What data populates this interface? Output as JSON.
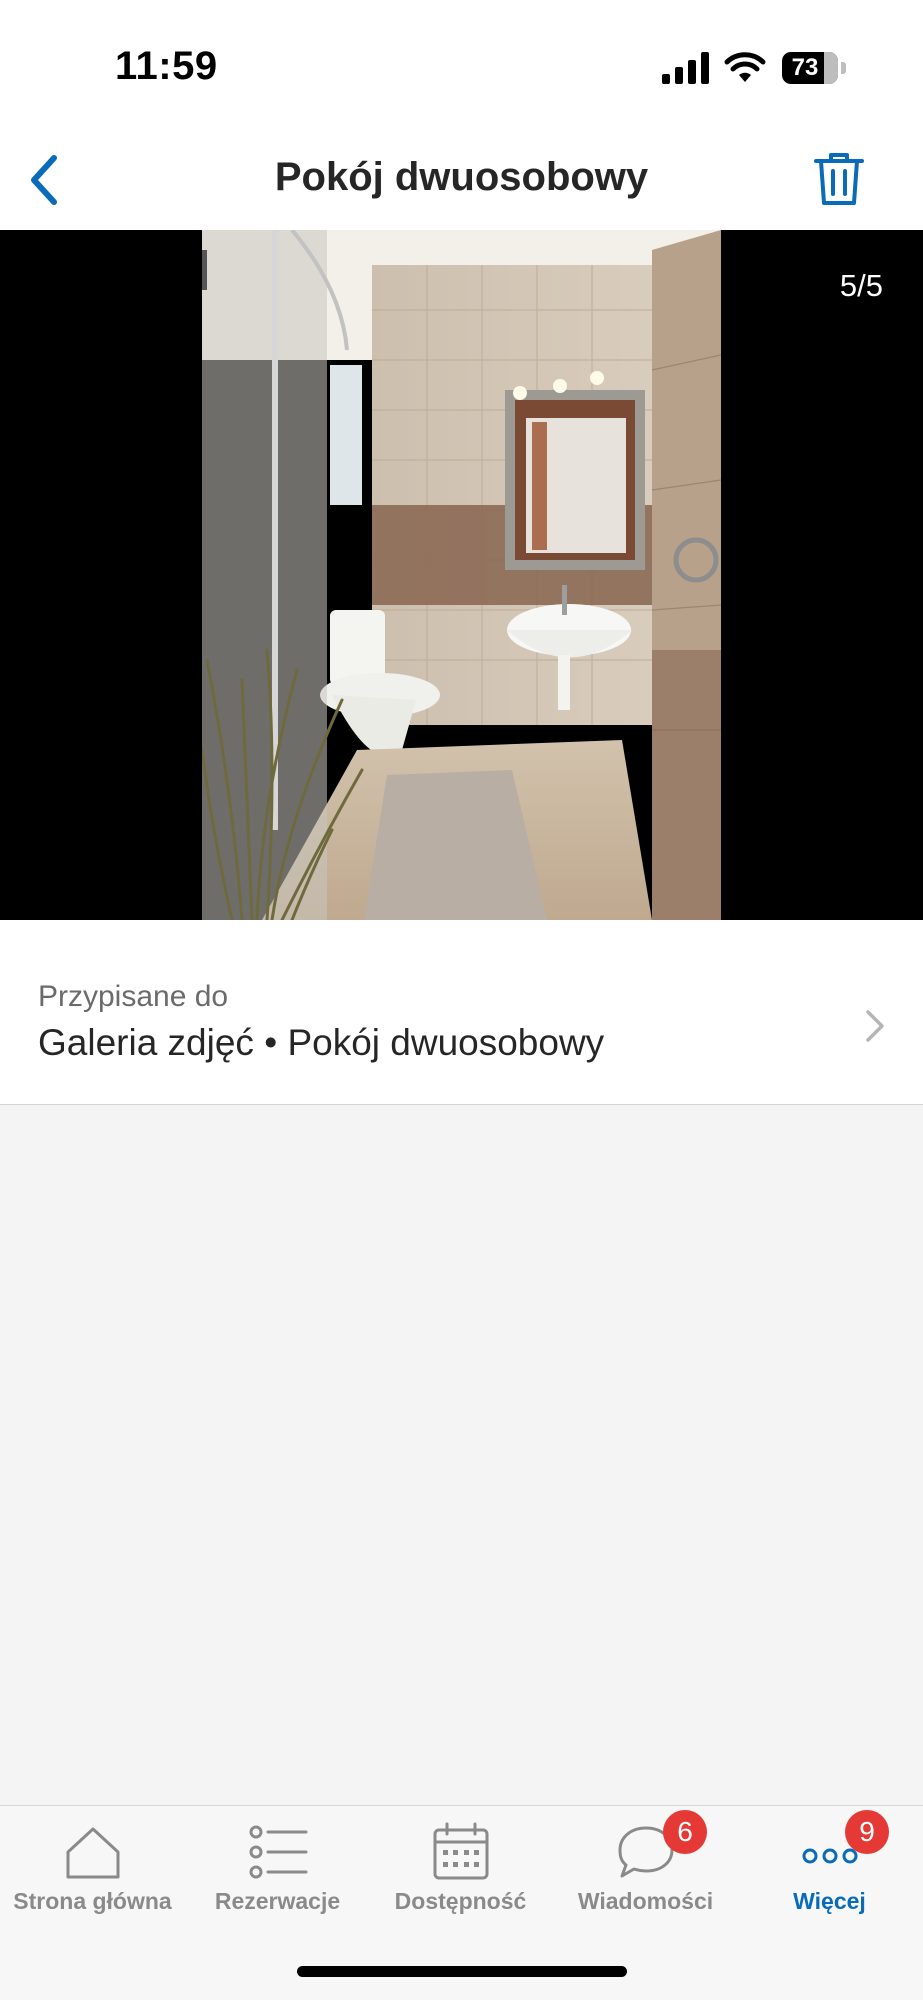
{
  "status_bar": {
    "time": "11:59",
    "battery": "73"
  },
  "header": {
    "title": "Pokój dwuosobowy",
    "back_icon": "chevron-left-icon",
    "delete_icon": "trash-icon",
    "accent_color": "#0a6bb8"
  },
  "photo": {
    "counter": "5/5",
    "subject": "bathroom"
  },
  "assigned": {
    "label": "Przypisane do",
    "value": "Galeria zdjęć • Pokój dwuosobowy"
  },
  "tabs": [
    {
      "label": "Strona główna",
      "icon": "home-icon",
      "active": false,
      "badge": ""
    },
    {
      "label": "Rezerwacje",
      "icon": "list-icon",
      "active": false,
      "badge": ""
    },
    {
      "label": "Dostępność",
      "icon": "calendar-icon",
      "active": false,
      "badge": ""
    },
    {
      "label": "Wiadomości",
      "icon": "chat-bubble-icon",
      "active": false,
      "badge": "6"
    },
    {
      "label": "Więcej",
      "icon": "more-dots-icon",
      "active": true,
      "badge": "9"
    }
  ]
}
